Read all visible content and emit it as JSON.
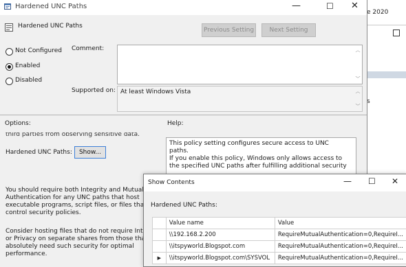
{
  "background_window": {
    "date_fragment": "e 2020",
    "side_fragment": "s"
  },
  "window": {
    "title": "Hardened UNC Paths",
    "controls": {
      "minimize": "—",
      "maximize": "☐",
      "close": "✕"
    }
  },
  "header": {
    "policy_name": "Hardened UNC Paths",
    "previous_button": "Previous Setting",
    "next_button": "Next Setting"
  },
  "state": {
    "options": [
      {
        "label": "Not Configured",
        "selected": false
      },
      {
        "label": "Enabled",
        "selected": true
      },
      {
        "label": "Disabled",
        "selected": false
      }
    ]
  },
  "comment": {
    "label": "Comment:",
    "value": ""
  },
  "supported": {
    "label": "Supported on:",
    "value": "At least Windows Vista"
  },
  "options_section": {
    "label": "Options:",
    "clipped_text": "third parties from observing sensitive data.",
    "field_label": "Hardened UNC Paths:",
    "show_button": "Show...",
    "para1": "You should require both Integrity and Mutual Authentication for any UNC paths that host executable programs, script files, or files that control security policies.",
    "para2": "Consider hosting files that do not require Integrity or Privacy on separate shares from those that absolutely need such security for optimal performance."
  },
  "help_section": {
    "label": "Help:",
    "para1": "This policy setting configures secure access to UNC paths.",
    "para2": "If you enable this policy, Windows only allows access to the specified UNC paths after fulfilling additional security"
  },
  "show_contents": {
    "title": "Show Contents",
    "caption": "Hardened UNC Paths:",
    "columns": [
      "Value name",
      "Value"
    ],
    "rows": [
      {
        "marker": "",
        "name": "\\\\192.168.2.200",
        "value": "RequireMutualAuthentication=0,RequireI..."
      },
      {
        "marker": "",
        "name": "\\\\itspyworld.Blogspot.com",
        "value": "RequireMutualAuthentication=0,RequireI..."
      },
      {
        "marker": "▶",
        "name": "\\\\itspyworld.Blogspot.com\\SYSVOL",
        "value": "RequireMutualAuthentication=0,RequireI..."
      }
    ]
  }
}
